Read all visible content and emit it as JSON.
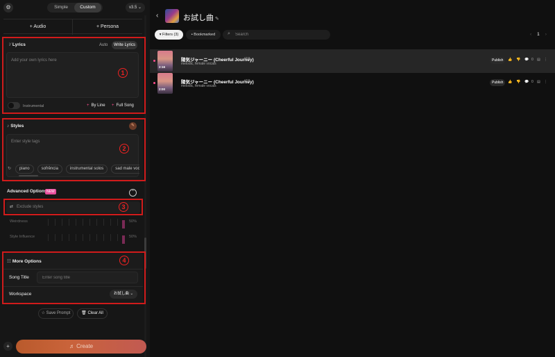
{
  "topbar": {
    "mode_simple": "Simple",
    "mode_custom": "Custom",
    "version": "v3.5 ⌄",
    "gear_icon": "gear-icon"
  },
  "add_buttons": {
    "audio": "+  Audio",
    "persona": "+  Persona"
  },
  "lyrics": {
    "title": "Lyrics",
    "icon": "lyrics-icon",
    "auto": "Auto",
    "write": "Write Lyrics",
    "placeholder": "Add your own lyrics here",
    "instrumental": "Instrumental",
    "by_line": "By Line",
    "full_song": "Full Song"
  },
  "styles": {
    "title": "Styles",
    "placeholder": "Enter style tags",
    "chips": [
      "piano",
      "sofrência",
      "instrumental solos",
      "sad male vocals"
    ]
  },
  "advanced": {
    "title": "Advanced Options",
    "badge": "NEW",
    "exclude_placeholder": "Exclude styles",
    "sliders": [
      {
        "label": "Weirdness",
        "value": "50%"
      },
      {
        "label": "Style Influence",
        "value": "50%"
      }
    ]
  },
  "more_options": {
    "title": "More Options",
    "song_title_label": "Song Title",
    "song_title_placeholder": "Enter song title",
    "workspace_label": "Workspace",
    "workspace_value": "お試し曲 ⌄"
  },
  "actions": {
    "save_prompt": "Save Prompt",
    "clear_all": "Clear All",
    "create": "Create"
  },
  "annotations": [
    "1",
    "2",
    "3",
    "4"
  ],
  "workspace": {
    "title": "お試し曲"
  },
  "filters": {
    "filters": "Filters (3)",
    "bookmarked": "Bookmarked",
    "search_placeholder": "Search",
    "page": "1"
  },
  "songs": [
    {
      "title": "陽気ジャーニー (Cheerful Journey)",
      "version": "v3.5",
      "tags": "melodic, female vocals",
      "duration": "2:16",
      "publish": "Publish",
      "likes": "0"
    },
    {
      "title": "陽気ジャーニー (Cheerful Journey)",
      "version": "v3.5",
      "tags": "melodic, female vocals",
      "duration": "2:00",
      "publish": "Publish",
      "likes": "0"
    }
  ],
  "colors": {
    "annotation_red": "#d11b1b",
    "accent_pink": "#ff4d8d",
    "create_orange": "#c9633a"
  }
}
